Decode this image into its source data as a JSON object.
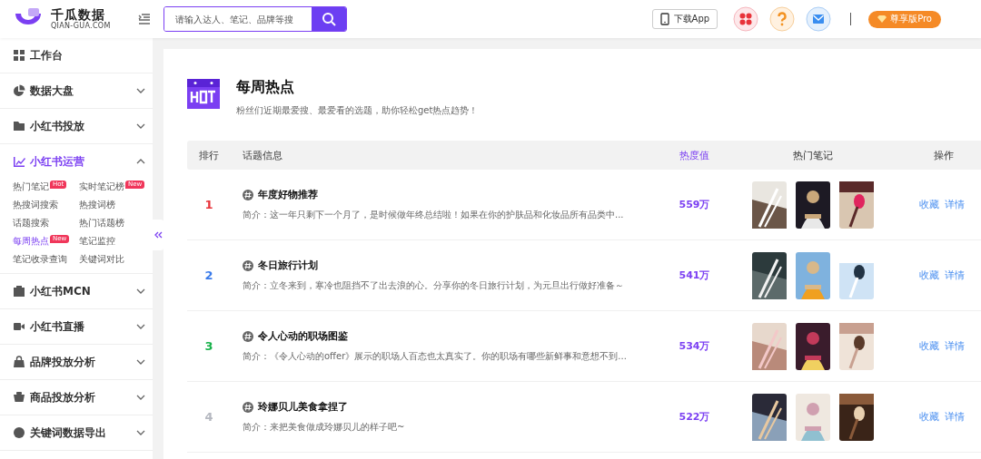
{
  "header": {
    "logo_title": "千瓜数据",
    "logo_subtitle": "QIAN-GUA.COM",
    "search": {
      "placeholder": "请输入达人、笔记、品牌等搜"
    },
    "download_button": "下载App",
    "pro_button": "尊享版Pro"
  },
  "sidebar": {
    "items": [
      {
        "label": "工作台",
        "expanded": false,
        "has_caret": false
      },
      {
        "label": "数据大盘",
        "expanded": false,
        "has_caret": true
      },
      {
        "label": "小红书投放",
        "expanded": false,
        "has_caret": true
      },
      {
        "label": "小红书运营",
        "expanded": true,
        "has_caret": true,
        "children": [
          {
            "label": "热门笔记",
            "badge": "Hot",
            "selected": false
          },
          {
            "label": "实时笔记榜",
            "badge": "New",
            "selected": false
          },
          {
            "label": "热搜词搜索",
            "selected": false
          },
          {
            "label": "热搜词榜",
            "selected": false
          },
          {
            "label": "话题搜索",
            "selected": false
          },
          {
            "label": "热门话题榜",
            "selected": false
          },
          {
            "label": "每周热点",
            "badge": "New",
            "selected": true
          },
          {
            "label": "笔记监控",
            "selected": false
          },
          {
            "label": "笔记收录查询",
            "selected": false
          },
          {
            "label": "关键词对比",
            "selected": false
          }
        ]
      },
      {
        "label": "小红书MCN",
        "expanded": false,
        "has_caret": true
      },
      {
        "label": "小红书直播",
        "expanded": false,
        "has_caret": true
      },
      {
        "label": "品牌投放分析",
        "expanded": false,
        "has_caret": true
      },
      {
        "label": "商品投放分析",
        "expanded": false,
        "has_caret": true
      },
      {
        "label": "关键词数据导出",
        "expanded": false,
        "has_caret": true
      }
    ]
  },
  "page": {
    "title": "每周热点",
    "subtitle": "粉丝们近期最爱搜、最爱看的选题，助你轻松get热点趋势！"
  },
  "table": {
    "columns": [
      "排行",
      "话题信息",
      "热度值",
      "热门笔记",
      "操作"
    ],
    "rows": [
      {
        "rank": "1",
        "color": "#e8333a",
        "topic": "年度好物推荐",
        "summary": "简介：这一年只剩下一个月了，是时候做年终总结啦！如果在你的护肤品和化妆品所有品类中...",
        "heat": "559万",
        "notes": [
          {
            "kind": "picture"
          },
          {
            "kind": "picture"
          },
          {
            "kind": "picture"
          }
        ],
        "actions": [
          "收藏",
          "详情"
        ]
      },
      {
        "rank": "2",
        "color": "#3a7bea",
        "topic": "冬日旅行计划",
        "summary": "简介：立冬来到，寒冷也阻挡不了出去浪的心。分享你的冬日旅行计划，为元旦出行做好准备～",
        "heat": "541万",
        "notes": [
          {
            "kind": "picture"
          },
          {
            "kind": "picture"
          },
          {
            "kind": "picture"
          }
        ],
        "actions": [
          "收藏",
          "详情"
        ]
      },
      {
        "rank": "3",
        "color": "#19b24b",
        "topic": "令人心动的职场图鉴",
        "summary": "简介：《令人心动的offer》展示的职场人百态也太真实了。你的职场有哪些新鲜事和意想不到...",
        "heat": "534万",
        "notes": [
          {
            "kind": "picture"
          },
          {
            "kind": "picture"
          },
          {
            "kind": "picture"
          }
        ],
        "actions": [
          "收藏",
          "详情"
        ]
      },
      {
        "rank": "4",
        "color": "#b5b8c0",
        "topic": "玲娜贝儿美食拿捏了",
        "summary": "简介：来把美食做成玲娜贝儿的样子吧~",
        "heat": "522万",
        "notes": [
          {
            "kind": "picture"
          },
          {
            "kind": "picture"
          },
          {
            "kind": "picture"
          }
        ],
        "actions": [
          "收藏",
          "详情"
        ]
      }
    ]
  }
}
